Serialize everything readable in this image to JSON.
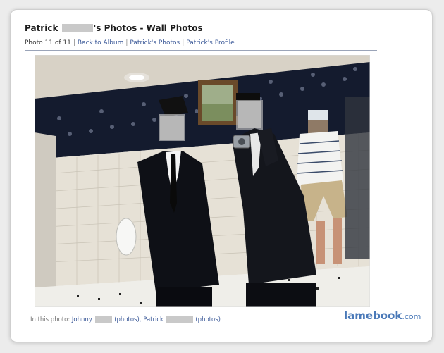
{
  "title": {
    "before": "Patrick",
    "after": "'s Photos - Wall Photos"
  },
  "nav": {
    "counter": "Photo 11 of 11",
    "sep": "|",
    "back": "Back to Album",
    "photos": "Patrick's Photos",
    "profile": "Patrick's Profile"
  },
  "caption": {
    "prefix": "In this photo:",
    "person1": "Johnny",
    "person1_photos": "(photos),",
    "person2": "Patrick",
    "person2_photos": "(photos)"
  },
  "watermark": {
    "brand": "lamebook",
    "domain": ".com"
  },
  "colors": {
    "link": "#3b5998",
    "brand": "#4a79b8"
  }
}
